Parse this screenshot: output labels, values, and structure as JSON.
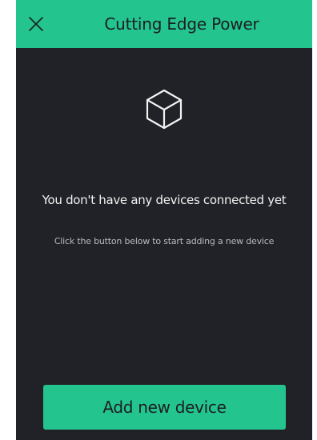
{
  "header": {
    "title": "Cutting Edge Power",
    "close_icon": "close-icon"
  },
  "empty_state": {
    "icon": "cube-icon",
    "title": "You don't have any devices connected yet",
    "subtitle": "Click the button below to start adding a new device"
  },
  "actions": {
    "add_device_label": "Add new device"
  },
  "colors": {
    "accent": "#23c48e",
    "background": "#212227",
    "text_primary": "#f2f2f2",
    "text_secondary": "#b8b8bc"
  }
}
